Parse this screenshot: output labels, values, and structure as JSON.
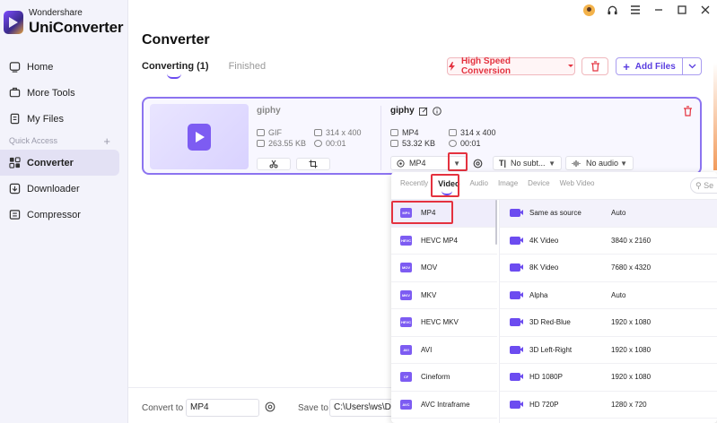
{
  "app": {
    "brand_top": "Wondershare",
    "brand_main": "UniConverter"
  },
  "sidebar": {
    "items": [
      {
        "label": "Home"
      },
      {
        "label": "More Tools"
      },
      {
        "label": "My Files"
      }
    ],
    "quick_access_label": "Quick Access",
    "quick_items": [
      {
        "label": "Converter"
      },
      {
        "label": "Downloader"
      },
      {
        "label": "Compressor"
      }
    ]
  },
  "header": {
    "title": "Converter",
    "tab_converting": "Converting (1)",
    "tab_finished": "Finished",
    "high_speed_label": "High Speed Conversion",
    "add_files_label": "Add Files"
  },
  "file": {
    "source": {
      "name": "giphy",
      "format": "GIF",
      "resolution": "314 x 400",
      "size": "263.55 KB",
      "duration": "00:01"
    },
    "output": {
      "name": "giphy",
      "format": "MP4",
      "resolution": "314 x 400",
      "size": "53.32 KB",
      "duration": "00:01",
      "format_select": "MP4",
      "subtitle_select": "No subt...",
      "audio_select": "No audio"
    }
  },
  "dropdown": {
    "tabs": [
      "Recently",
      "Video",
      "Audio",
      "Image",
      "Device",
      "Web Video"
    ],
    "search_placeholder": "Se",
    "formats": [
      {
        "label": "MP4",
        "badge": "MP4"
      },
      {
        "label": "HEVC MP4",
        "badge": "HEVC"
      },
      {
        "label": "MOV",
        "badge": "MOV"
      },
      {
        "label": "MKV",
        "badge": "MKV"
      },
      {
        "label": "HEVC MKV",
        "badge": "HEVC"
      },
      {
        "label": "AVI",
        "badge": "AVI"
      },
      {
        "label": "Cineform",
        "badge": "CF"
      },
      {
        "label": "AVC Intraframe",
        "badge": "AVC"
      }
    ],
    "resolutions": [
      {
        "name": "Same as source",
        "value": "Auto"
      },
      {
        "name": "4K Video",
        "value": "3840 x 2160"
      },
      {
        "name": "8K Video",
        "value": "7680 x 4320"
      },
      {
        "name": "Alpha",
        "value": "Auto"
      },
      {
        "name": "3D Red-Blue",
        "value": "1920 x 1080"
      },
      {
        "name": "3D Left-Right",
        "value": "1920 x 1080"
      },
      {
        "name": "HD 1080P",
        "value": "1920 x 1080"
      },
      {
        "name": "HD 720P",
        "value": "1280 x 720"
      }
    ]
  },
  "bottom": {
    "convert_to_label": "Convert to",
    "convert_to_value": "MP4",
    "save_to_label": "Save to",
    "save_to_value": "C:\\Users\\ws\\Desk"
  },
  "colors": {
    "accent": "#6c4cf0",
    "danger": "#e4323f"
  }
}
